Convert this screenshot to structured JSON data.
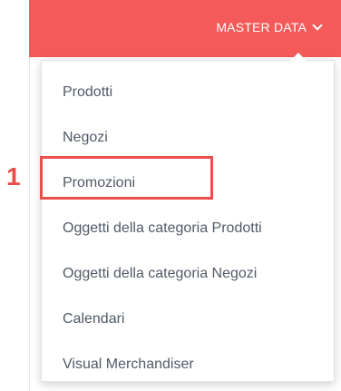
{
  "annotation": {
    "number": "1"
  },
  "header": {
    "menu_label": "MASTER DATA",
    "chevron_icon": "chevron-down-icon"
  },
  "menu": {
    "items": [
      {
        "label": "Prodotti"
      },
      {
        "label": "Negozi"
      },
      {
        "label": "Promozioni"
      },
      {
        "label": "Oggetti della categoria Prodotti"
      },
      {
        "label": "Oggetti della categoria Negozi"
      },
      {
        "label": "Calendari"
      },
      {
        "label": "Visual Merchandiser"
      }
    ]
  },
  "colors": {
    "accent": "#f45a59",
    "annotation": "#ea4f4c",
    "item_text": "#505a66"
  }
}
